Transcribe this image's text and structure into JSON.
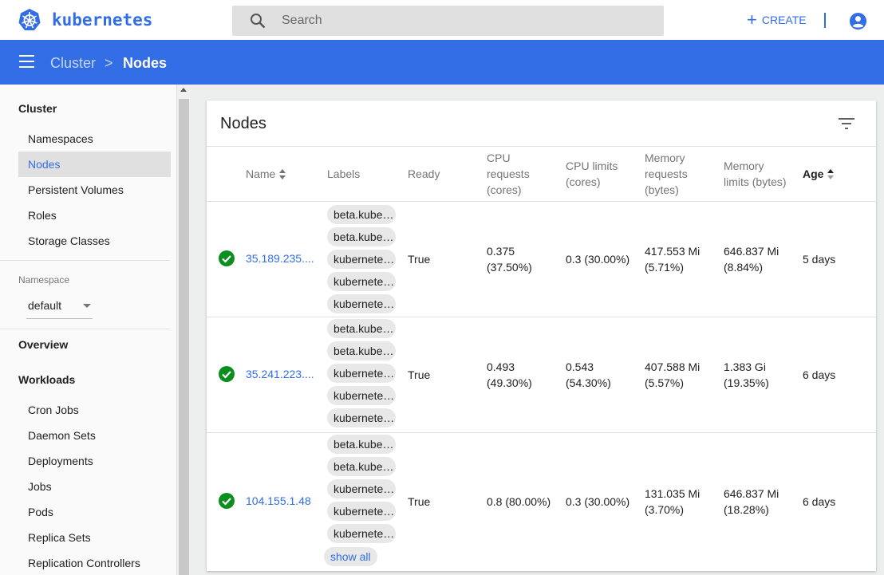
{
  "app": {
    "brand": "kubernetes"
  },
  "search": {
    "placeholder": "Search"
  },
  "header": {
    "create_label": "CREATE"
  },
  "breadcrumb": {
    "parent": "Cluster",
    "separator": ">",
    "current": "Nodes"
  },
  "sidebar": {
    "cluster_heading": "Cluster",
    "cluster_items": [
      "Namespaces",
      "Nodes",
      "Persistent Volumes",
      "Roles",
      "Storage Classes"
    ],
    "active_item": "Nodes",
    "namespace_label": "Namespace",
    "namespace_value": "default",
    "overview_heading": "Overview",
    "workloads_heading": "Workloads",
    "workload_items": [
      "Cron Jobs",
      "Daemon Sets",
      "Deployments",
      "Jobs",
      "Pods",
      "Replica Sets",
      "Replication Controllers"
    ]
  },
  "card": {
    "title": "Nodes",
    "columns": {
      "name": "Name",
      "labels": "Labels",
      "ready": "Ready",
      "cpu_requests": [
        "CPU",
        "requests",
        "(cores)"
      ],
      "cpu_limits": [
        "CPU limits",
        "(cores)"
      ],
      "mem_requests": [
        "Memory",
        "requests",
        "(bytes)"
      ],
      "mem_limits": [
        "Memory",
        "limits (bytes)"
      ],
      "age": "Age"
    },
    "rows": [
      {
        "name": "35.189.235....",
        "labels": [
          "beta.kubern...",
          "beta.kubern...",
          "kubernetes...",
          "kubernetes...",
          "kubernetes..."
        ],
        "ready": "True",
        "cpu_requests": [
          "0.375",
          "(37.50%)"
        ],
        "cpu_limits": [
          "0.3 (30.00%)"
        ],
        "mem_requests": [
          "417.553 Mi",
          "(5.71%)"
        ],
        "mem_limits": [
          "646.837 Mi",
          "(8.84%)"
        ],
        "age": "5 days"
      },
      {
        "name": "35.241.223....",
        "labels": [
          "beta.kubern...",
          "beta.kubern...",
          "kubernetes...",
          "kubernetes...",
          "kubernetes..."
        ],
        "ready": "True",
        "cpu_requests": [
          "0.493",
          "(49.30%)"
        ],
        "cpu_limits": [
          "0.543",
          "(54.30%)"
        ],
        "mem_requests": [
          "407.588 Mi",
          "(5.57%)"
        ],
        "mem_limits": [
          "1.383 Gi",
          "(19.35%)"
        ],
        "age": "6 days"
      },
      {
        "name": "104.155.1.48",
        "labels": [
          "beta.kubern...",
          "beta.kubern...",
          "kubernetes...",
          "kubernetes...",
          "kubernetes..."
        ],
        "ready": "True",
        "cpu_requests": [
          "0.8 (80.00%)"
        ],
        "cpu_limits": [
          "0.3 (30.00%)"
        ],
        "mem_requests": [
          "131.035 Mi",
          "(3.70%)"
        ],
        "mem_limits": [
          "646.837 Mi",
          "(18.28%)"
        ],
        "age": "6 days"
      }
    ],
    "show_all_label": "show all"
  },
  "colors": {
    "accent": "#326de6",
    "success": "#0b8e1e",
    "chip": "#e8e8e8"
  },
  "icons": [
    "kubernetes-logo-icon",
    "search-icon",
    "plus-icon",
    "account-icon",
    "menu-icon",
    "filter-icon",
    "check-circle-icon",
    "sort-icon"
  ]
}
